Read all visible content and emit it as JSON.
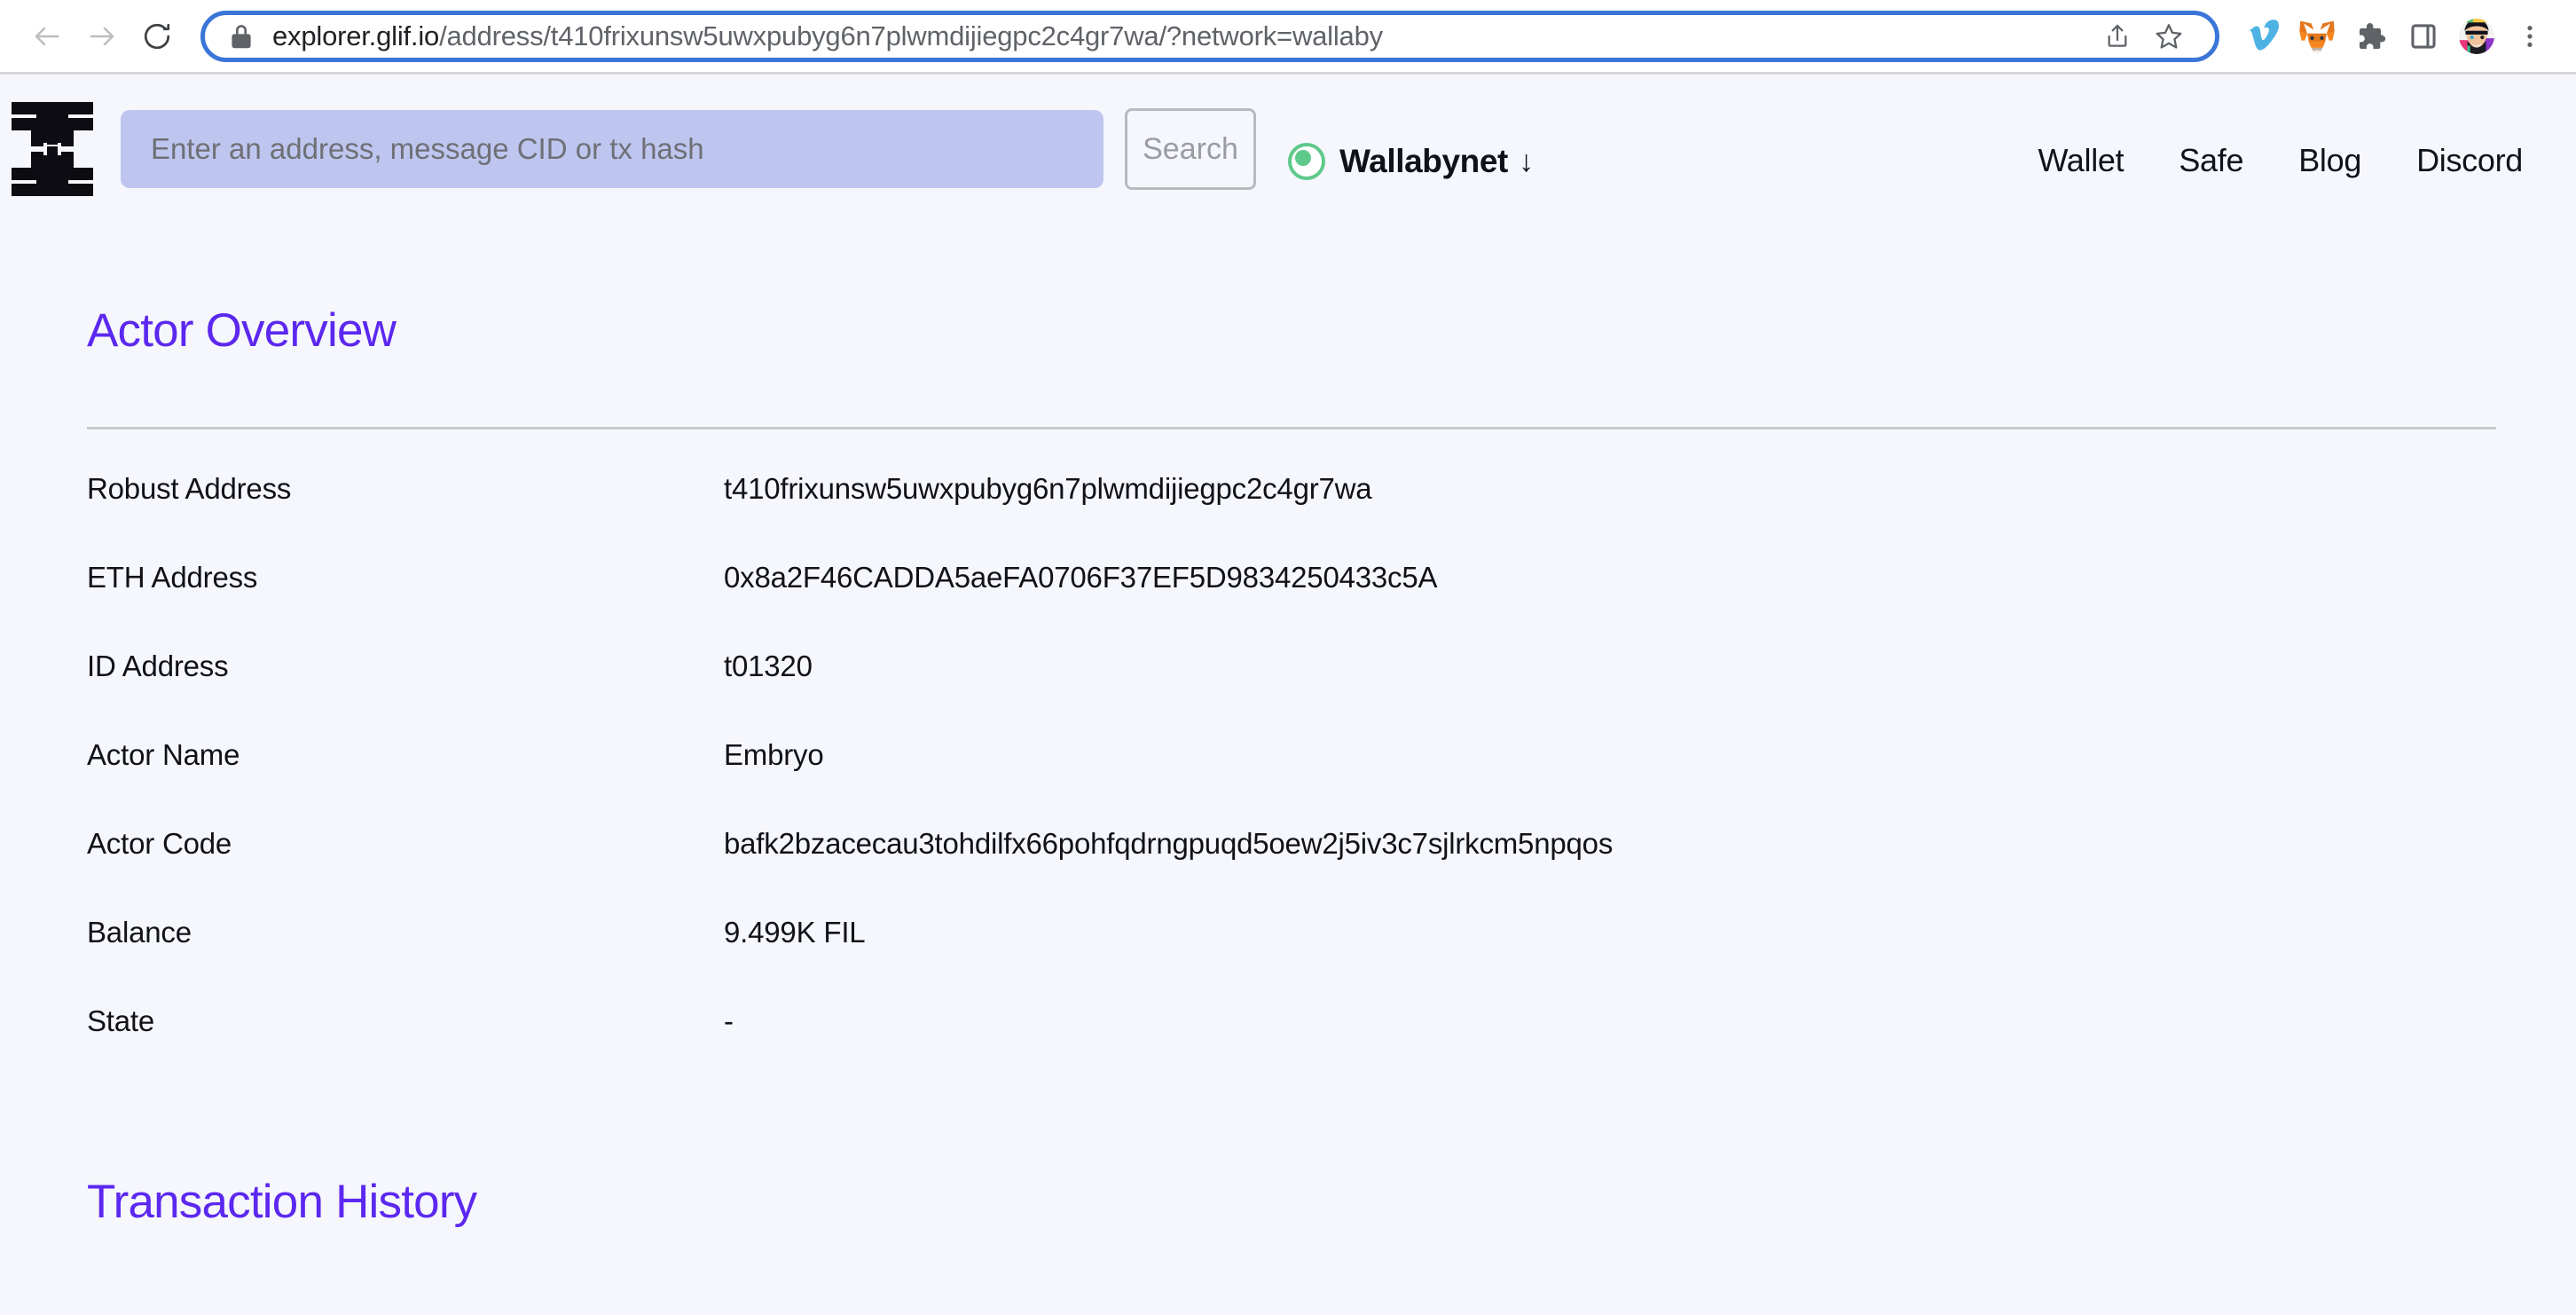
{
  "browser": {
    "back_label": "Back",
    "forward_label": "Forward",
    "reload_label": "Reload",
    "url_domain": "explorer.glif.io",
    "url_path": "/address/t410frixunsw5uwxpubyg6n7plwmdijiegpc2c4gr7wa/?network=wallaby",
    "lock_icon": "lock-icon",
    "share_icon": "share-icon",
    "bookmark_icon": "star-icon",
    "extensions": [
      {
        "name": "vimeo-extension-icon",
        "label": "Vimeo"
      },
      {
        "name": "metamask-extension-icon",
        "label": "MetaMask"
      },
      {
        "name": "extensions-puzzle-icon",
        "label": "Extensions"
      },
      {
        "name": "side-panel-icon",
        "label": "Side panel"
      },
      {
        "name": "profile-avatar-icon",
        "label": "Profile"
      },
      {
        "name": "chrome-menu-icon",
        "label": "Customize and control Google Chrome"
      }
    ]
  },
  "header": {
    "logo_name": "glif-logo",
    "search": {
      "placeholder": "Enter an address, message CID or tx hash",
      "value": "",
      "button_label": "Search"
    },
    "network": {
      "label": "Wallabynet",
      "arrow": "↓",
      "status_color": "#5fc98b"
    },
    "nav_links": [
      {
        "label": "Wallet"
      },
      {
        "label": "Safe"
      },
      {
        "label": "Blog"
      },
      {
        "label": "Discord"
      }
    ]
  },
  "main": {
    "overview_title": "Actor Overview",
    "accent_color": "#5c28f0",
    "rows": [
      {
        "key": "Robust Address",
        "value": "t410frixunsw5uwxpubyg6n7plwmdijiegpc2c4gr7wa"
      },
      {
        "key": "ETH Address",
        "value": "0x8a2F46CADDA5aeFA0706F37EF5D9834250433c5A"
      },
      {
        "key": "ID Address",
        "value": "t01320"
      },
      {
        "key": "Actor Name",
        "value": "Embryo"
      },
      {
        "key": "Actor Code",
        "value": "bafk2bzacecau3tohdilfx66pohfqdrngpuqd5oew2j5iv3c7sjlrkcm5npqos"
      },
      {
        "key": "Balance",
        "value": "9.499K FIL"
      },
      {
        "key": "State",
        "value": "-"
      }
    ],
    "history_title": "Transaction History"
  }
}
